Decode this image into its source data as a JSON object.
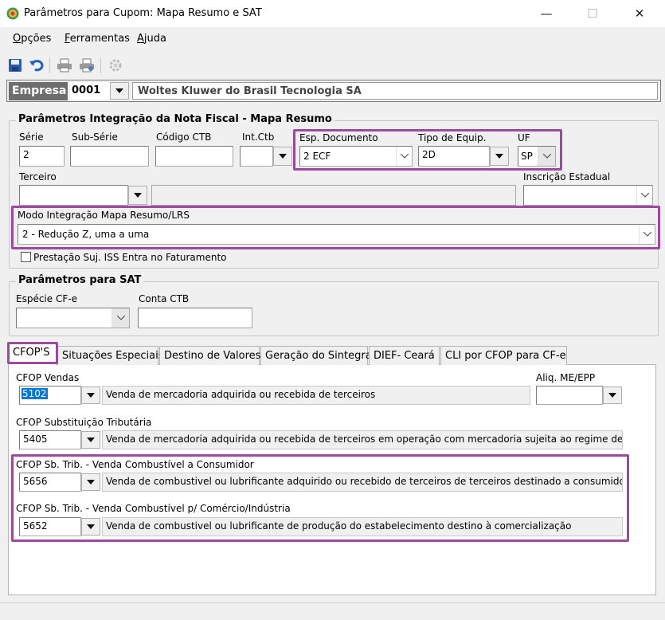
{
  "window": {
    "title": "Parâmetros para Cupom: Mapa Resumo e SAT",
    "minimize": "—",
    "maximize": "☐",
    "close": "✕"
  },
  "menu": [
    {
      "label": "Opções",
      "underline": "O",
      "rest": "pções"
    },
    {
      "label": "Ferramentas",
      "underline": "F",
      "rest": "erramentas"
    },
    {
      "label": "Ajuda",
      "underline": "A",
      "rest": "juda"
    }
  ],
  "toolbar": {
    "icons": [
      "save-icon",
      "undo-icon",
      "print-icon",
      "print-setup-icon",
      "settings-icon"
    ]
  },
  "empresa": {
    "label": "Empresa",
    "code": "0001",
    "name": "Woltes Kluwer do Brasil Tecnologia SA"
  },
  "nf_group": {
    "title": "Parâmetros Integração da Nota Fiscal - Mapa Resumo",
    "serie": {
      "label": "Série",
      "value": "2"
    },
    "subserie": {
      "label": "Sub-Série",
      "value": ""
    },
    "codigo_ctb": {
      "label": "Código CTB",
      "value": ""
    },
    "int_ctb": {
      "label": "Int.Ctb",
      "value": ""
    },
    "esp_documento": {
      "label": "Esp. Documento",
      "value": "2 ECF"
    },
    "tipo_equip": {
      "label": "Tipo de Equip.",
      "value": "2D"
    },
    "uf": {
      "label": "UF",
      "value": "SP"
    },
    "terceiro": {
      "label": "Terceiro",
      "value": ""
    },
    "inscricao_estadual": {
      "label": "Inscrição Estadual",
      "value": ""
    },
    "modo_integracao": {
      "label": "Modo Integração Mapa Resumo/LRS",
      "value": "2 - Redução Z, uma a uma"
    },
    "prestacao_iss": {
      "label": "Prestação Suj. ISS Entra no Faturamento",
      "checked": false
    }
  },
  "sat_group": {
    "title": "Parâmetros para SAT",
    "especie_cfe": {
      "label": "Espécie CF-e",
      "value": ""
    },
    "conta_ctb": {
      "label": "Conta CTB",
      "value": ""
    }
  },
  "tabs": [
    {
      "label": "CFOP'S"
    },
    {
      "label": "Situações Especiais"
    },
    {
      "label": "Destino de Valores"
    },
    {
      "label": "Geração do Sintegra"
    },
    {
      "label": "DIEF- Ceará"
    },
    {
      "label": "CLI por CFOP para CF-e"
    }
  ],
  "cfop": {
    "vendas": {
      "label": "CFOP Vendas",
      "code": "5102",
      "desc": "Venda de mercadoria adquirida ou recebida de terceiros"
    },
    "aliq": {
      "label": "Aliq. ME/EPP",
      "value": ""
    },
    "subst": {
      "label": "CFOP Substituição Tributária",
      "code": "5405",
      "desc": "Venda de mercadoria adquirida ou recebida de terceiros em operação com mercadoria sujeita ao regime de s"
    },
    "comb_consumidor": {
      "label": "CFOP Sb. Trib. - Venda Combustível a Consumidor",
      "code": "5656",
      "desc": "Venda de combustivel ou lubrificante adquirido ou recebido de terceiros de terceiros destinado a consumidor"
    },
    "comb_comercio": {
      "label": "CFOP Sb. Trib. - Venda Combustível p/ Comércio/Indústria",
      "code": "5652",
      "desc": "Venda de combustivel ou lubrificante de produção do estabelecimento destino à comercialização"
    }
  },
  "colors": {
    "highlight": "#9b4aa0",
    "selection": "#0078d7"
  }
}
